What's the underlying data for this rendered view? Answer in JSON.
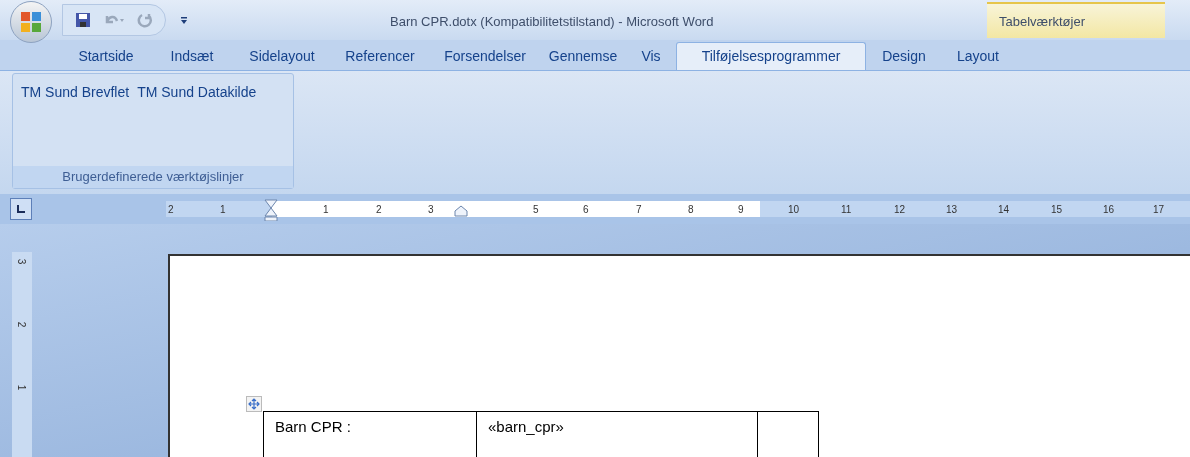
{
  "window": {
    "title": "Barn CPR.dotx (Kompatibilitetstilstand) - Microsoft Word",
    "context_tab_group": "Tabelværktøjer"
  },
  "tabs": [
    {
      "label": "Startside",
      "selected": false
    },
    {
      "label": "Indsæt",
      "selected": false
    },
    {
      "label": "Sidelayout",
      "selected": false
    },
    {
      "label": "Referencer",
      "selected": false
    },
    {
      "label": "Forsendelser",
      "selected": false
    },
    {
      "label": "Gennemse",
      "selected": false
    },
    {
      "label": "Vis",
      "selected": false
    },
    {
      "label": "Tilføjelsesprogrammer",
      "selected": true
    },
    {
      "label": "Design",
      "selected": false
    },
    {
      "label": "Layout",
      "selected": false
    }
  ],
  "ribbon": {
    "group": {
      "label": "Brugerdefinerede værktøjslinjer",
      "buttons": [
        "TM Sund Brevflet",
        "TM Sund Datakilde"
      ]
    }
  },
  "ruler": {
    "labels": [
      "2",
      "1",
      "1",
      "2",
      "3",
      "5",
      "6",
      "7",
      "8",
      "9",
      "10",
      "11",
      "12",
      "13",
      "14",
      "15",
      "16",
      "17"
    ]
  },
  "vertical_ruler": {
    "labels": [
      "3",
      "2",
      "1"
    ]
  },
  "document": {
    "table": {
      "rows": [
        {
          "label": "Barn CPR :",
          "value": "«barn_cpr»"
        }
      ]
    }
  }
}
